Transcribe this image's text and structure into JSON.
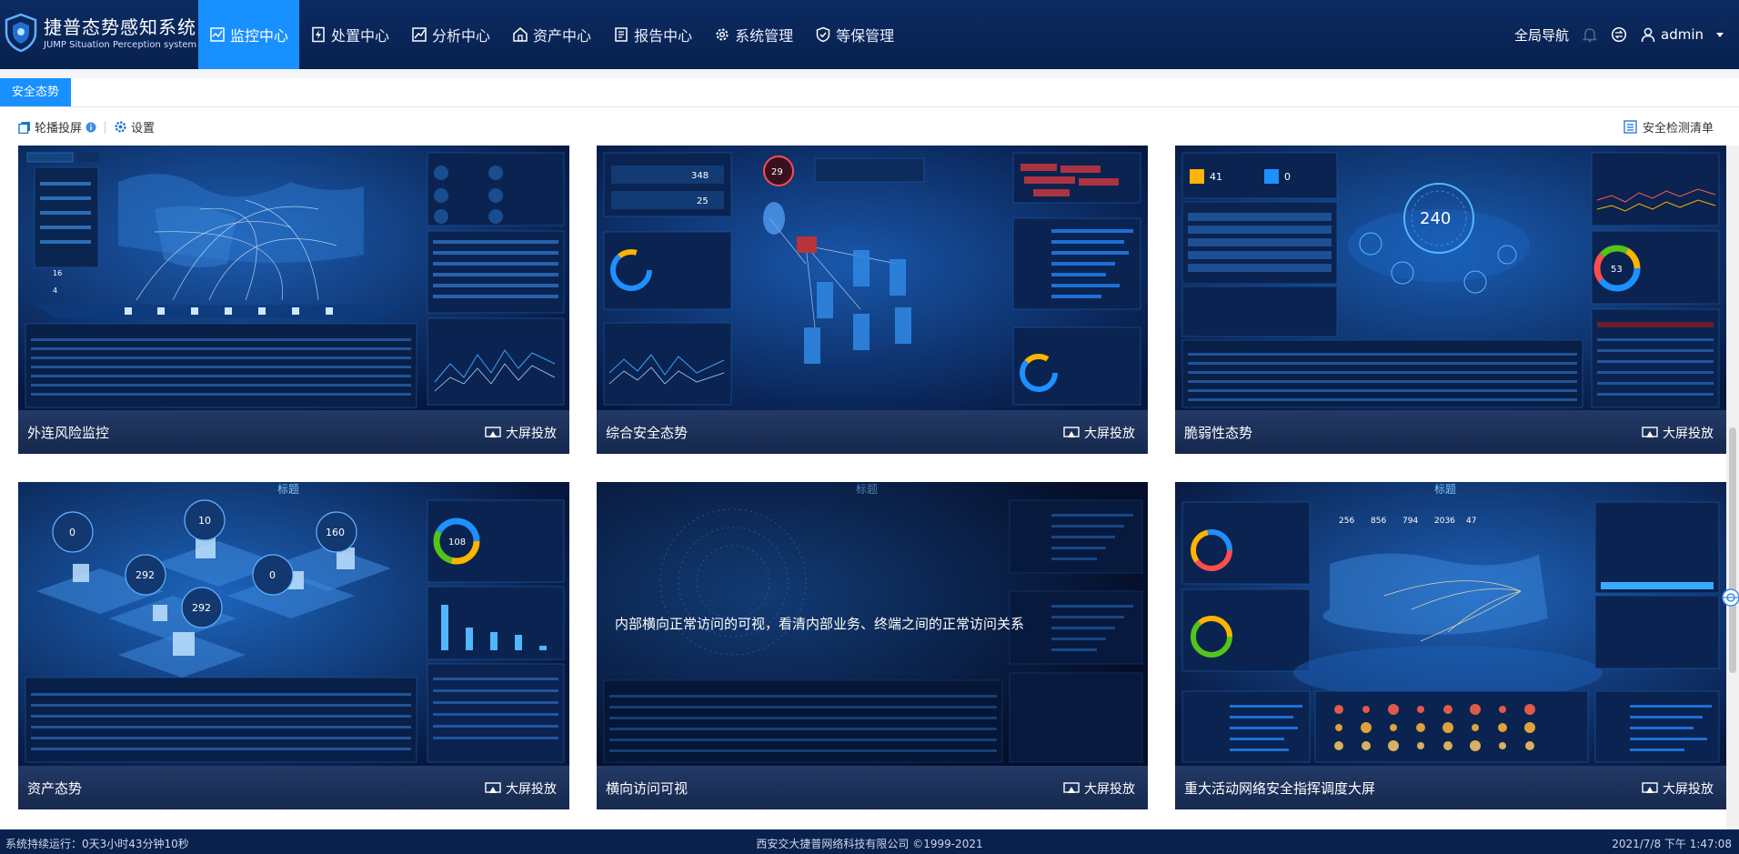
{
  "app": {
    "title": "捷普态势感知系统",
    "subtitle": "JUMP Situation Perception system",
    "logo_icon": "shield-logo-icon"
  },
  "nav": {
    "items": [
      {
        "label": "监控中心",
        "icon": "monitor-icon",
        "active": true
      },
      {
        "label": "处置中心",
        "icon": "bolt-doc-icon",
        "active": false
      },
      {
        "label": "分析中心",
        "icon": "chart-icon",
        "active": false
      },
      {
        "label": "资产中心",
        "icon": "home-icon",
        "active": false
      },
      {
        "label": "报告中心",
        "icon": "report-icon",
        "active": false
      },
      {
        "label": "系统管理",
        "icon": "gear-icon",
        "active": false
      },
      {
        "label": "等保管理",
        "icon": "shield-check-icon",
        "active": false
      }
    ],
    "global_nav": "全局导航",
    "user": "admin"
  },
  "tabs": [
    {
      "label": "安全态势",
      "active": true
    }
  ],
  "toolbar": {
    "carousel_label": "轮播投屏",
    "settings_label": "设置",
    "checklist_label": "安全检测清单"
  },
  "cards": [
    {
      "title": "外连风险监控",
      "cast_label": "大屏投放",
      "overlay": ""
    },
    {
      "title": "综合安全态势",
      "cast_label": "大屏投放",
      "overlay": ""
    },
    {
      "title": "脆弱性态势",
      "cast_label": "大屏投放",
      "overlay": ""
    },
    {
      "title": "资产态势",
      "cast_label": "大屏投放",
      "overlay": ""
    },
    {
      "title": "横向访问可视",
      "cast_label": "大屏投放",
      "overlay": "内部横向正常访问的可视，看清内部业务、终端之间的正常访问关系"
    },
    {
      "title": "重大活动网络安全指挥调度大屏",
      "cast_label": "大屏投放",
      "overlay": ""
    }
  ],
  "thumb_text": {
    "c1_total": "16",
    "c1_src": "4",
    "c2_center": "29",
    "c2_v1": "348",
    "c2_v2": "25",
    "c3_score": "240",
    "c3_a": "41",
    "c3_b": "0",
    "c3_ring": "53",
    "c4_title": "标题",
    "c4_n0": "0",
    "c4_n10": "10",
    "c4_n160": "160",
    "c4_n292a": "292",
    "c4_n292b": "292",
    "c4_n0b": "0",
    "c4_ring": "108",
    "c5_title": "标题",
    "c6_title": "标题",
    "c6_stats": [
      "256",
      "856",
      "794",
      "2036",
      "47"
    ]
  },
  "footer": {
    "uptime": "系统持续运行：0天3小时43分钟10秒",
    "company": "西安交大捷普网络科技有限公司 ©1999-2021",
    "datetime": "2021/7/8 下午 1:47:08"
  }
}
